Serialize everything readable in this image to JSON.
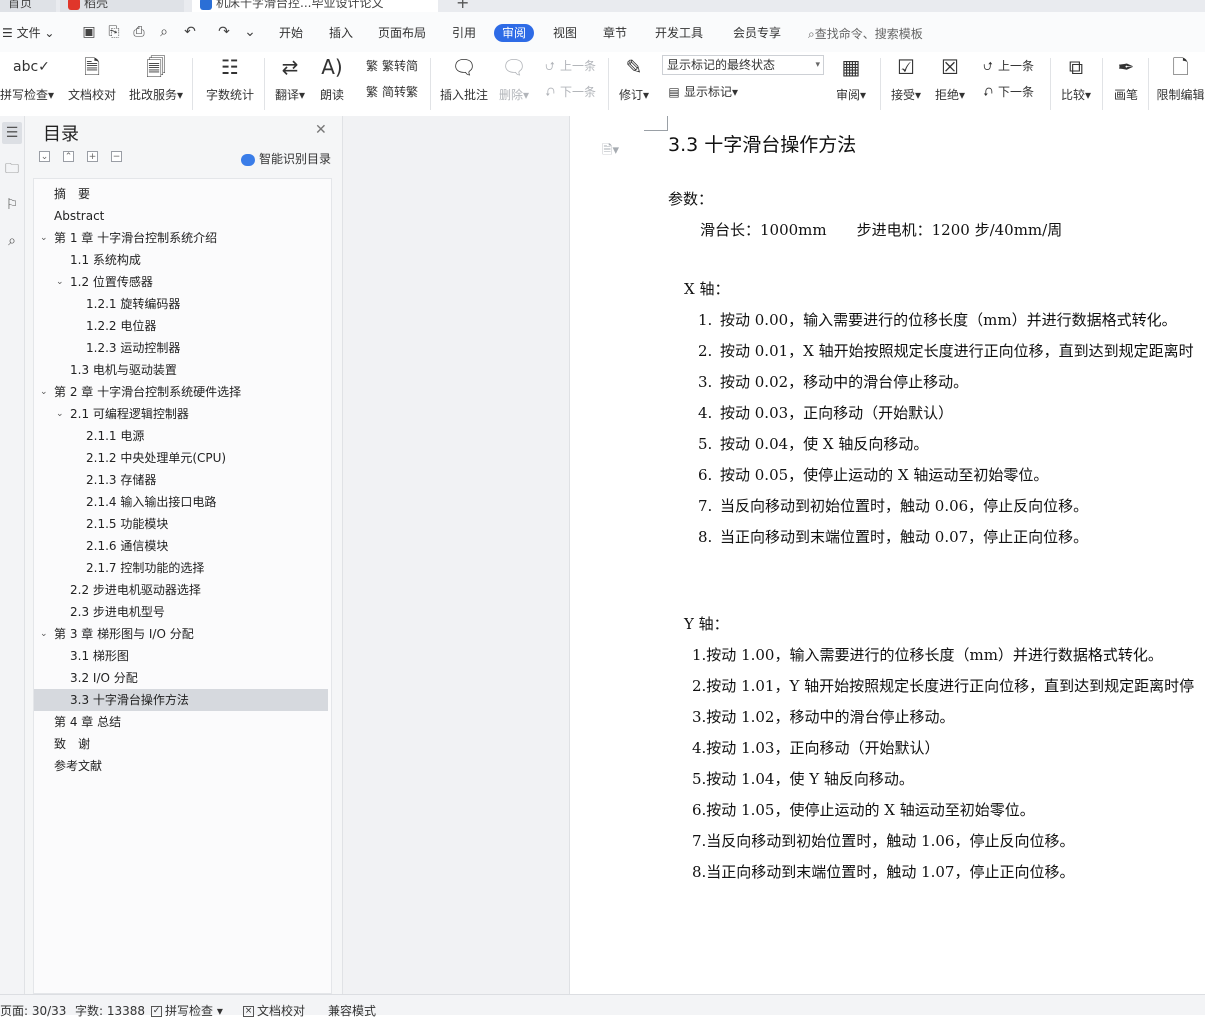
{
  "tabs": [
    {
      "label": "首页"
    },
    {
      "label": "稻壳"
    },
    {
      "label": "机床十字滑台控...毕业设计论文"
    },
    {
      "label": "+"
    }
  ],
  "menu": {
    "file": "文件",
    "items": [
      "开始",
      "插入",
      "页面布局",
      "引用",
      "审阅",
      "视图",
      "章节",
      "开发工具",
      "会员专享"
    ],
    "active": "审阅",
    "search": "查找命令、搜索模板"
  },
  "ribbon": {
    "spellcheck": "拼写检查",
    "doc_proof": "文档校对",
    "review_service": "批改服务",
    "word_count": "字数统计",
    "translate": "翻译",
    "read_aloud": "朗读",
    "trad_to_simp": "繁转简",
    "simp_to_trad": "简转繁",
    "insert_comment": "插入批注",
    "delete": "删除",
    "prev": "上一条",
    "next": "下一条",
    "track": "修订",
    "markup_state": "显示标记的最终状态",
    "show_markup": "显示标记",
    "review": "审阅",
    "accept": "接受",
    "reject": "拒绝",
    "prev2": "上一条",
    "next2": "下一条",
    "compare": "比较",
    "ink": "画笔",
    "restrict": "限制编辑"
  },
  "nav": {
    "title": "目录",
    "smart_toc": "智能识别目录",
    "toc": [
      {
        "text": "摘　要",
        "level": 0,
        "arrow": false
      },
      {
        "text": "Abstract",
        "level": 0,
        "arrow": false
      },
      {
        "text": "第 1 章  十字滑台控制系统介绍",
        "level": 0,
        "arrow": true
      },
      {
        "text": "1.1 系统构成",
        "level": 1,
        "arrow": false
      },
      {
        "text": "1.2 位置传感器",
        "level": 1,
        "arrow": true
      },
      {
        "text": "1.2.1 旋转编码器",
        "level": 2,
        "arrow": false
      },
      {
        "text": "1.2.2 电位器",
        "level": 2,
        "arrow": false
      },
      {
        "text": "1.2.3 运动控制器",
        "level": 2,
        "arrow": false
      },
      {
        "text": "1.3 电机与驱动装置",
        "level": 1,
        "arrow": false
      },
      {
        "text": "第 2 章  十字滑台控制系统硬件选择",
        "level": 0,
        "arrow": true
      },
      {
        "text": "2.1 可编程逻辑控制器",
        "level": 1,
        "arrow": true
      },
      {
        "text": "2.1.1 电源",
        "level": 2,
        "arrow": false
      },
      {
        "text": "2.1.2 中央处理单元(CPU)",
        "level": 2,
        "arrow": false
      },
      {
        "text": "2.1.3 存储器",
        "level": 2,
        "arrow": false
      },
      {
        "text": "2.1.4 输入输出接口电路",
        "level": 2,
        "arrow": false
      },
      {
        "text": "2.1.5 功能模块",
        "level": 2,
        "arrow": false
      },
      {
        "text": "2.1.6 通信模块",
        "level": 2,
        "arrow": false
      },
      {
        "text": "2.1.7 控制功能的选择",
        "level": 2,
        "arrow": false
      },
      {
        "text": "2.2 步进电机驱动器选择",
        "level": 1,
        "arrow": false
      },
      {
        "text": "2.3 步进电机型号",
        "level": 1,
        "arrow": false
      },
      {
        "text": "第 3 章  梯形图与 I/O 分配",
        "level": 0,
        "arrow": true
      },
      {
        "text": "3.1 梯形图",
        "level": 1,
        "arrow": false
      },
      {
        "text": "3.2 I/O 分配",
        "level": 1,
        "arrow": false
      },
      {
        "text": "3.3 十字滑台操作方法",
        "level": 1,
        "arrow": false,
        "selected": true
      },
      {
        "text": "第 4 章  总结",
        "level": 0,
        "arrow": false
      },
      {
        "text": "致　谢",
        "level": 0,
        "arrow": false
      },
      {
        "text": "参考文献",
        "level": 0,
        "arrow": false
      }
    ]
  },
  "doc": {
    "heading": "3.3 十字滑台操作方法",
    "params_label": "参数：",
    "params_line": "滑台长：1000mm　　步进电机：1200 步/40mm/周",
    "x_label": "X 轴：",
    "x_items": [
      {
        "num": "1.",
        "text": "按动 0.00，输入需要进行的位移长度（mm）并进行数据格式转化。"
      },
      {
        "num": "2.",
        "text": "按动 0.01，X 轴开始按照规定长度进行正向位移，直到达到规定距离时"
      },
      {
        "num": "3.",
        "text": "按动 0.02，移动中的滑台停止移动。"
      },
      {
        "num": "4.",
        "text": "按动 0.03，正向移动（开始默认）"
      },
      {
        "num": "5.",
        "text": "按动 0.04，使 X 轴反向移动。"
      },
      {
        "num": "6.",
        "text": "按动 0.05，使停止运动的 X 轴运动至初始零位。"
      },
      {
        "num": "7.",
        "text": "当反向移动到初始位置时，触动 0.06，停止反向位移。"
      },
      {
        "num": "8.",
        "text": "当正向移动到末端位置时，触动 0.07，停止正向位移。"
      }
    ],
    "y_label": "Y 轴：",
    "y_items": [
      "1.按动 1.00，输入需要进行的位移长度（mm）并进行数据格式转化。",
      "2.按动 1.01，Y 轴开始按照规定长度进行正向位移，直到达到规定距离时停",
      "3.按动 1.02，移动中的滑台停止移动。",
      "4.按动 1.03，正向移动（开始默认）",
      "5.按动 1.04，使 Y 轴反向移动。",
      "6.按动 1.05，使停止运动的 X 轴运动至初始零位。",
      "7.当反向移动到初始位置时，触动 1.06，停止反向位移。",
      "8.当正向移动到末端位置时，触动 1.07，停止正向位移。"
    ]
  },
  "status": {
    "page": "页面: 30/33",
    "words": "字数: 13388",
    "spell": "拼写检查",
    "proof": "文档校对",
    "compat": "兼容模式"
  },
  "colors": {
    "accent": "#2e6be6",
    "selected_toc": "#d6d9de"
  }
}
